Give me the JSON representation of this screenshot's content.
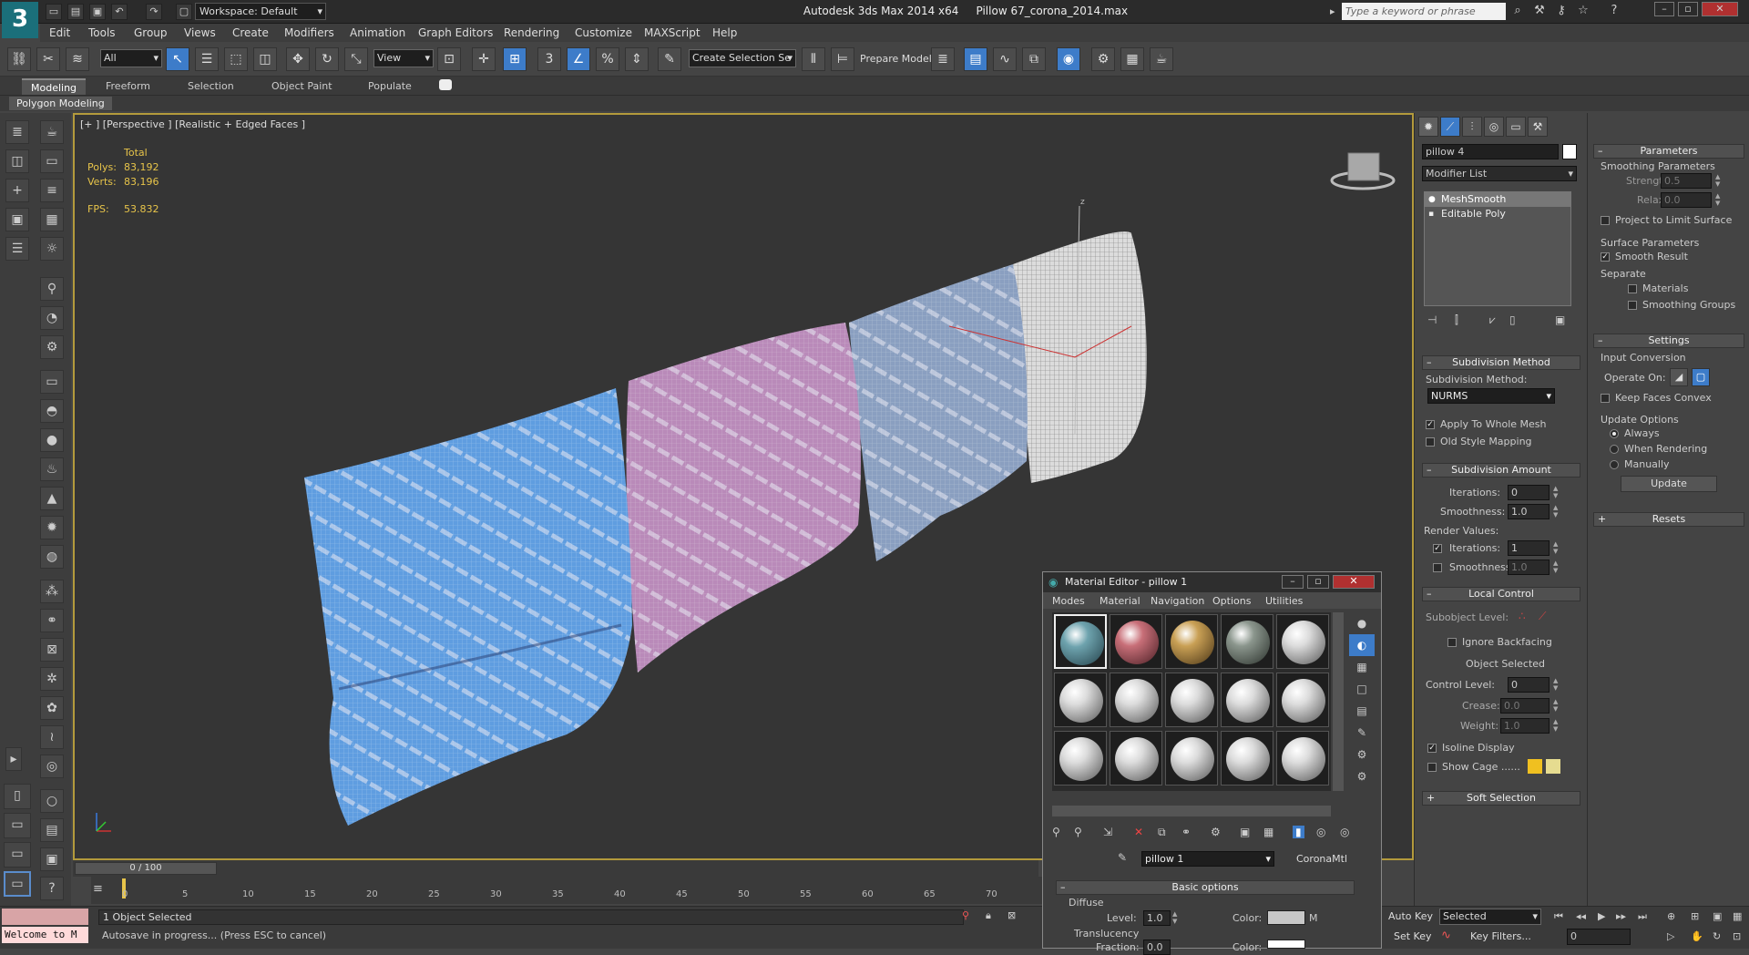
{
  "app": {
    "workspace": "Workspace: Default",
    "title_app": "Autodesk 3ds Max  2014 x64",
    "title_file": "Pillow 67_corona_2014.max",
    "search_placeholder": "Type a keyword or phrase",
    "logo": "3"
  },
  "menu": [
    "Edit",
    "Tools",
    "Group",
    "Views",
    "Create",
    "Modifiers",
    "Animation",
    "Graph Editors",
    "Rendering",
    "Customize",
    "MAXScript",
    "Help"
  ],
  "toolbar": {
    "filter": "All",
    "refcoord": "View",
    "selset": "Create Selection Se",
    "prepare": "Prepare Model",
    "snap_label": "3",
    "percent_label": "%"
  },
  "ribbon": {
    "tabs": [
      "Modeling",
      "Freeform",
      "Selection",
      "Object Paint",
      "Populate"
    ],
    "active_panel": "Polygon Modeling"
  },
  "viewport": {
    "label": "[+ ] [Perspective ] [Realistic + Edged Faces ]",
    "stats": {
      "total": "Total",
      "polys_label": "Polys:",
      "polys": "83,192",
      "verts_label": "Verts:",
      "verts": "83,196",
      "fps_label": "FPS:",
      "fps": "53.832"
    },
    "axis_z": "z",
    "colors": {
      "pillow_blue": "#5f9de0",
      "pillow_pink": "#b97fb6",
      "pillow_gray": "#8a9fc0",
      "pillow_white": "#e6e6e6",
      "accent": "#b39a3c"
    }
  },
  "command_panel": {
    "object_name": "pillow 4",
    "modifier_list": "Modifier List",
    "stack": [
      "MeshSmooth",
      "Editable Poly"
    ],
    "subdivision_method": {
      "title": "Subdivision Method",
      "label": "Subdivision Method:",
      "value": "NURMS",
      "apply_whole": "Apply To Whole Mesh",
      "old_style": "Old Style Mapping"
    },
    "subdivision_amount": {
      "title": "Subdivision Amount",
      "iterations_label": "Iterations:",
      "iterations": "0",
      "smoothness_label": "Smoothness:",
      "smoothness": "1.0",
      "render_values": "Render Values:",
      "r_iterations_label": "Iterations:",
      "r_iterations": "1",
      "r_smoothness_label": "Smoothness:",
      "r_smoothness": "1.0"
    },
    "local_control": {
      "title": "Local Control",
      "subobject_level": "Subobject Level:",
      "ignore_backfacing": "Ignore Backfacing",
      "object_selected": "Object Selected",
      "control_level_label": "Control Level:",
      "control_level": "0",
      "crease_label": "Crease:",
      "crease": "0.0",
      "weight_label": "Weight:",
      "weight": "1.0",
      "isoline": "Isoline Display",
      "show_cage": "Show Cage ......"
    },
    "soft_selection": "Soft Selection"
  },
  "parameters": {
    "title": "Parameters",
    "smoothing_params": "Smoothing Parameters",
    "strength_label": "Strength:",
    "strength": "0.5",
    "relax_label": "Relax:",
    "relax": "0.0",
    "project_limit": "Project to Limit Surface",
    "surface_params": "Surface Parameters",
    "smooth_result": "Smooth Result",
    "separate": "Separate",
    "materials": "Materials",
    "smoothing_groups": "Smoothing Groups",
    "settings": "Settings",
    "input_conversion": "Input Conversion",
    "operate_on": "Operate On:",
    "keep_faces_convex": "Keep Faces Convex",
    "update_options": "Update Options",
    "always": "Always",
    "when_rendering": "When Rendering",
    "manually": "Manually",
    "update": "Update",
    "resets": "Resets"
  },
  "material_editor": {
    "title": "Material Editor - pillow 1",
    "menu": [
      "Modes",
      "Material",
      "Navigation",
      "Options",
      "Utilities"
    ],
    "material_name": "pillow 1",
    "material_type": "CoronaMtl",
    "basic_options": "Basic options",
    "diffuse": "Diffuse",
    "level_label": "Level:",
    "level": "1.0",
    "color_label": "Color:",
    "m": "M",
    "translucency": "Translucency",
    "fraction_label": "Fraction:",
    "fraction": "0.0",
    "color2_label": "Color:",
    "swatches": [
      "#6ea3ae",
      "#c86f78",
      "#c9a055",
      "#8b968d",
      "#dcdcdc",
      "#dcdcdc",
      "#dcdcdc",
      "#dcdcdc",
      "#dcdcdc",
      "#dcdcdc",
      "#dcdcdc",
      "#dcdcdc",
      "#dcdcdc",
      "#dcdcdc",
      "#dcdcdc"
    ]
  },
  "timeline": {
    "frame": "0 / 100",
    "ticks": [
      "0",
      "5",
      "10",
      "15",
      "20",
      "25",
      "30",
      "35",
      "40",
      "45",
      "50",
      "55",
      "60",
      "65",
      "70"
    ]
  },
  "status": {
    "welcome": "Welcome to M",
    "selected": "1 Object Selected",
    "autosave": "Autosave in progress... (Press ESC to cancel)",
    "auto_key": "Auto Key",
    "set_key": "Set Key",
    "selected_dd": "Selected",
    "key_filters": "Key Filters...",
    "frame_field": "0"
  }
}
